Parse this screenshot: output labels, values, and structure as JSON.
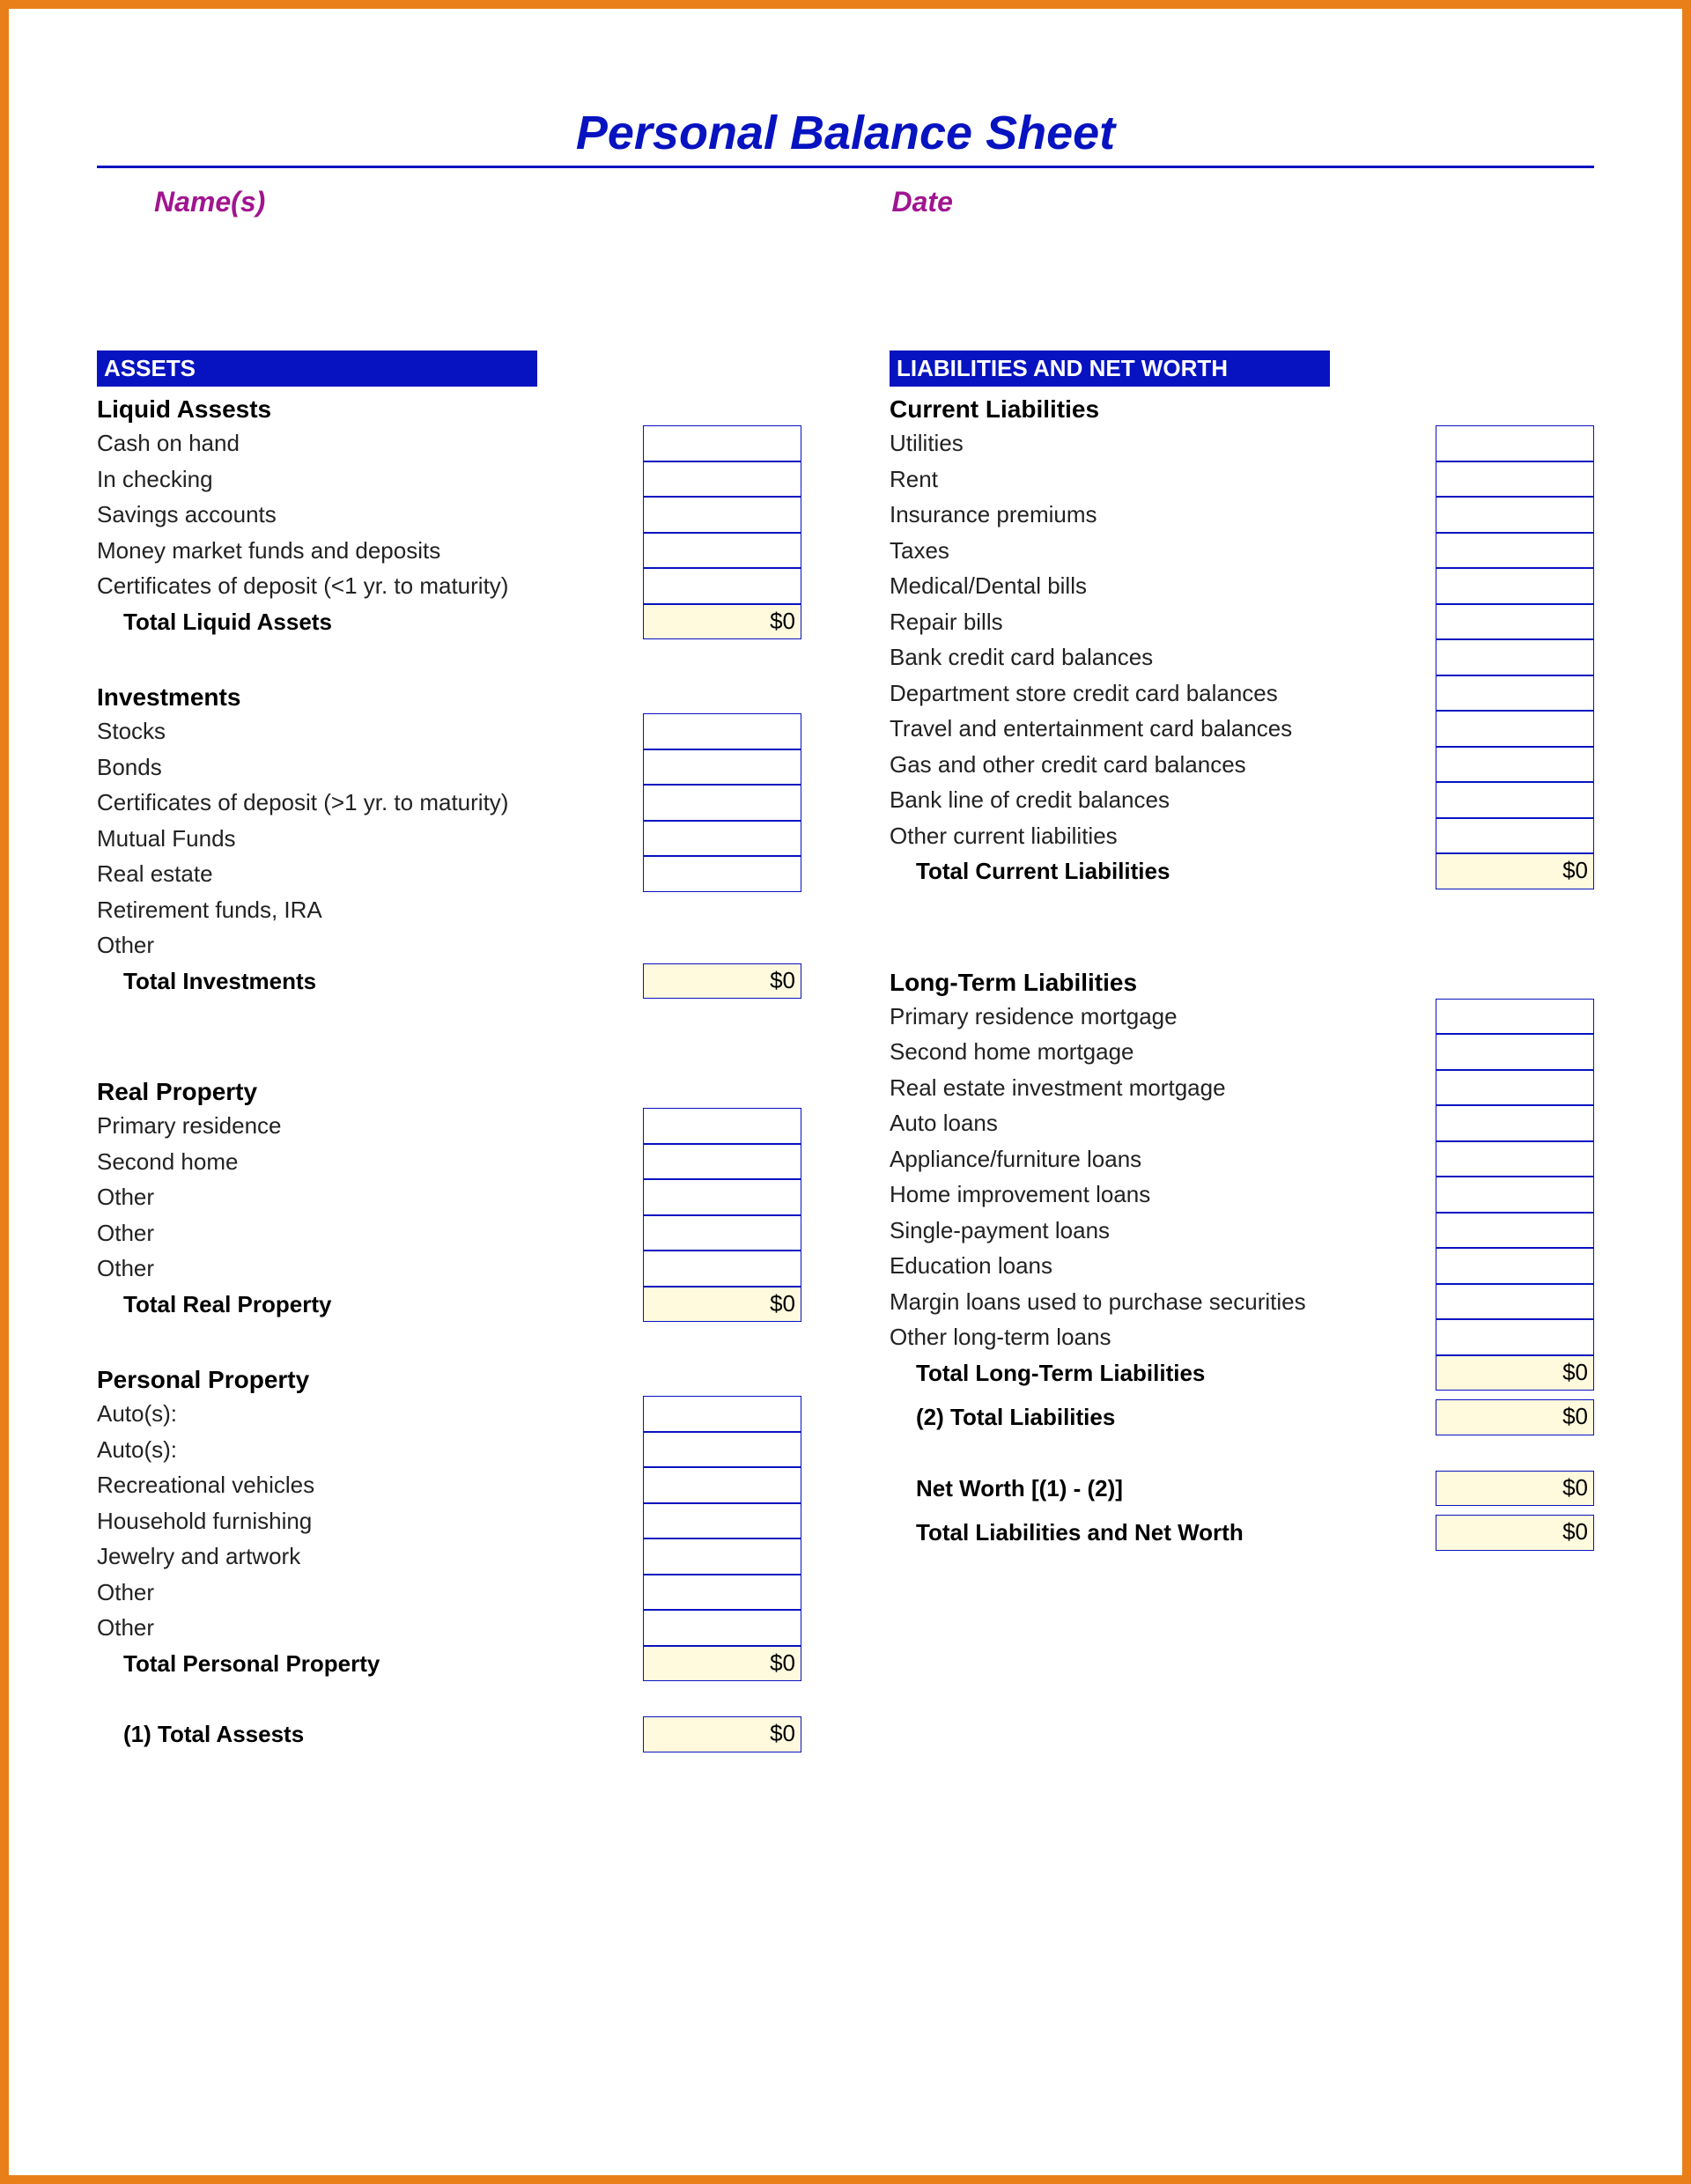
{
  "title": "Personal Balance Sheet",
  "header": {
    "names_label": "Name(s)",
    "date_label": "Date"
  },
  "left": {
    "banner": "ASSETS",
    "liquid": {
      "title": "Liquid Assests",
      "items": [
        "Cash on hand",
        "In checking",
        "Savings accounts",
        "Money market funds and deposits",
        "Certificates of deposit (<1 yr. to maturity)"
      ],
      "total_label": "Total Liquid Assets",
      "total_value": "$0"
    },
    "investments": {
      "title": "Investments",
      "items_with_input": [
        "Stocks",
        "Bonds",
        "Certificates of deposit (>1 yr. to maturity)",
        "Mutual Funds",
        "Real estate"
      ],
      "items_without_input": [
        "Retirement funds, IRA",
        "Other"
      ],
      "total_label": "Total Investments",
      "total_value": "$0"
    },
    "real_property": {
      "title": "Real Property",
      "items": [
        "Primary residence",
        "Second home",
        "Other",
        "Other",
        "Other"
      ],
      "total_label": "Total Real Property",
      "total_value": "$0"
    },
    "personal_property": {
      "title": "Personal Property",
      "items": [
        "Auto(s):",
        "Auto(s):",
        "Recreational vehicles",
        "Household furnishing",
        "Jewelry and artwork",
        "Other",
        "Other"
      ],
      "total_label": "Total Personal Property",
      "total_value": "$0"
    },
    "grand_total": {
      "label": "(1) Total Assests",
      "value": "$0"
    }
  },
  "right": {
    "banner": "LIABILITIES AND NET WORTH",
    "current": {
      "title": "Current Liabilities",
      "items": [
        "Utilities",
        "Rent",
        "Insurance premiums",
        "Taxes",
        "Medical/Dental bills",
        "Repair bills",
        "Bank credit card balances",
        "Department store credit card balances",
        "Travel and entertainment card balances",
        "Gas and other credit card balances",
        "Bank line of credit balances",
        "Other current liabilities"
      ],
      "total_label": "Total Current Liabilities",
      "total_value": "$0"
    },
    "longterm": {
      "title": "Long-Term Liabilities",
      "items": [
        "Primary residence mortgage",
        "Second home mortgage",
        "Real estate investment mortgage",
        "Auto loans",
        "Appliance/furniture loans",
        "Home improvement loans",
        "Single-payment loans",
        "Education loans",
        "Margin loans used to purchase securities",
        "Other long-term loans"
      ],
      "total_label": "Total Long-Term Liabilities",
      "total_value": "$0"
    },
    "total_liabilities": {
      "label": "(2) Total Liabilities",
      "value": "$0"
    },
    "net_worth": {
      "label": "Net Worth [(1) - (2)]",
      "value": "$0"
    },
    "total_lnw": {
      "label": "Total Liabilities and Net Worth",
      "value": "$0"
    }
  }
}
